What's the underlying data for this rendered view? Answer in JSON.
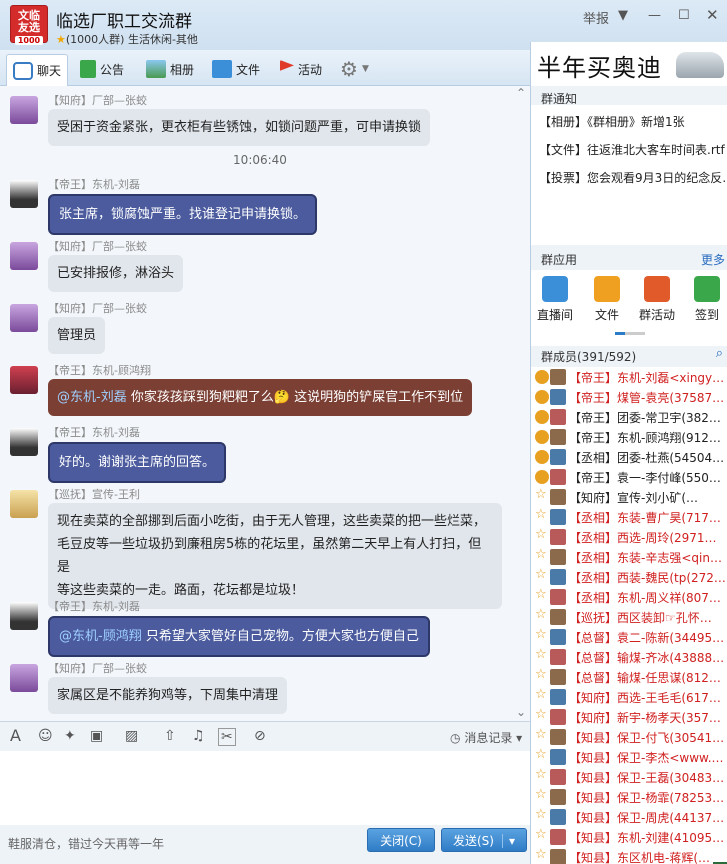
{
  "window": {
    "group_badge_top": "文临",
    "group_badge_mid": "友选",
    "group_badge_num": "1000",
    "title": "临选厂职工交流群",
    "subtitle": "(1000人群) 生活休闲-其他",
    "report_label": "举报"
  },
  "tabs": [
    {
      "label": "聊天"
    },
    {
      "label": "公告"
    },
    {
      "label": "相册"
    },
    {
      "label": "文件"
    },
    {
      "label": "活动"
    }
  ],
  "messages": [
    {
      "sender": "【知府】厂部—张蛟",
      "text": "受困于资金紧张，更衣柜有些锈蚀，如锁问题严重，可申请换锁"
    },
    {
      "timestamp": "10:06:40"
    },
    {
      "sender": "【帝王】东机-刘磊",
      "text": "张主席，锁腐蚀严重。找谁登记申请换锁。"
    },
    {
      "sender": "【知府】厂部—张蛟",
      "text": "已安排报修，淋浴头"
    },
    {
      "sender": "【知府】厂部—张蛟",
      "text": "管理员"
    },
    {
      "sender": "【帝王】东机-顾鸿翔",
      "mention": "@东机-刘磊",
      "text": " 你家孩孩踩到狗粑粑了么🤔 这说明狗的铲屎官工作不到位"
    },
    {
      "sender": "【帝王】东机-刘磊",
      "text": "好的。谢谢张主席的回答。"
    },
    {
      "sender": "【巡抚】宣传-王利",
      "lines": [
        "现在卖菜的全部挪到后面小吃街，由于无人管理，这些卖菜的把一些烂菜，",
        "毛豆皮等一些垃圾扔到廉租房5栋的花坛里，虽然第二天早上有人打扫，但是",
        "等这些卖菜的一走。路面，花坛都是垃圾！"
      ]
    },
    {
      "sender": "【帝王】东机-刘磊",
      "mention": "@东机-顾鸿翔",
      "text": " 只希望大家管好自己宠物。方便大家也方便自己"
    },
    {
      "sender": "【知府】厂部—张蛟",
      "text": "家属区是不能养狗鸡等，下周集中清理"
    }
  ],
  "input": {
    "history_label": "消息记录",
    "signature": "鞋服清仓，错过今天再等一年",
    "close_label": "关闭(C)",
    "send_label": "发送(S)"
  },
  "right": {
    "ad_text": "半年买奥迪",
    "notice_title": "群通知",
    "notices": [
      "【相册】《群相册》新增1张",
      "【文件】往返淮北大客车时间表.rtf",
      "【投票】您会观看9月3日的纪念反…"
    ],
    "apps_title": "群应用",
    "apps_more": "更多",
    "apps": [
      {
        "label": "直播间",
        "color": "#3a8fd8"
      },
      {
        "label": "文件",
        "color": "#f0a020"
      },
      {
        "label": "群活动",
        "color": "#e05a2a"
      },
      {
        "label": "签到",
        "color": "#3aa84a"
      }
    ],
    "members_title": "群成员(391/592)",
    "members": [
      {
        "text": "【帝王】东机-刘磊<xingy…",
        "color": "#d02020"
      },
      {
        "text": "【帝王】煤管-袁亮(37587…",
        "color": "#d02020"
      },
      {
        "text": "【帝王】团委-常卫宇(382…",
        "color": "#222222"
      },
      {
        "text": "【帝王】东机-顾鸿翔(912…",
        "color": "#222222"
      },
      {
        "text": "【丞相】团委-杜燕(54504…",
        "color": "#222222"
      },
      {
        "text": "【帝王】袁一-李付峰(550…",
        "color": "#222222"
      },
      {
        "text": "【知府】宣传-刘小矿(…",
        "color": "#222222"
      },
      {
        "text": "【丞相】东装-曹广昊(717…",
        "color": "#d02020"
      },
      {
        "text": "【丞相】西选-周玲(2971…",
        "color": "#d02020"
      },
      {
        "text": "【丞相】东装-辛志强<qin…",
        "color": "#d02020"
      },
      {
        "text": "【丞相】西装-魏民(tp(272…",
        "color": "#d02020"
      },
      {
        "text": "【丞相】东机-周义祥(807…",
        "color": "#d02020"
      },
      {
        "text": "【巡抚】西区装卸☞孔怀…",
        "color": "#d02020"
      },
      {
        "text": "【总督】袁二-陈新(34495…",
        "color": "#d02020"
      },
      {
        "text": "【总督】输煤-齐冰(43888…",
        "color": "#d02020"
      },
      {
        "text": "【总督】输煤-任思谋(812…",
        "color": "#d02020"
      },
      {
        "text": "【知府】西选-王毛毛(617…",
        "color": "#d02020"
      },
      {
        "text": "【知府】新宇-杨孝天(357…",
        "color": "#d02020"
      },
      {
        "text": "【知县】保卫-付飞(30541…",
        "color": "#d02020"
      },
      {
        "text": "【知县】保卫-李杰<www.…",
        "color": "#d02020"
      },
      {
        "text": "【知县】保卫-王磊(30483…",
        "color": "#d02020"
      },
      {
        "text": "【知县】保卫-杨霏(78253…",
        "color": "#d02020"
      },
      {
        "text": "【知县】保卫-周虎(44137…",
        "color": "#d02020"
      },
      {
        "text": "【知县】东机-刘建(41095…",
        "color": "#d02020"
      },
      {
        "text": "【知县】东区机电-蒋辉(…",
        "color": "#d02020"
      }
    ]
  }
}
